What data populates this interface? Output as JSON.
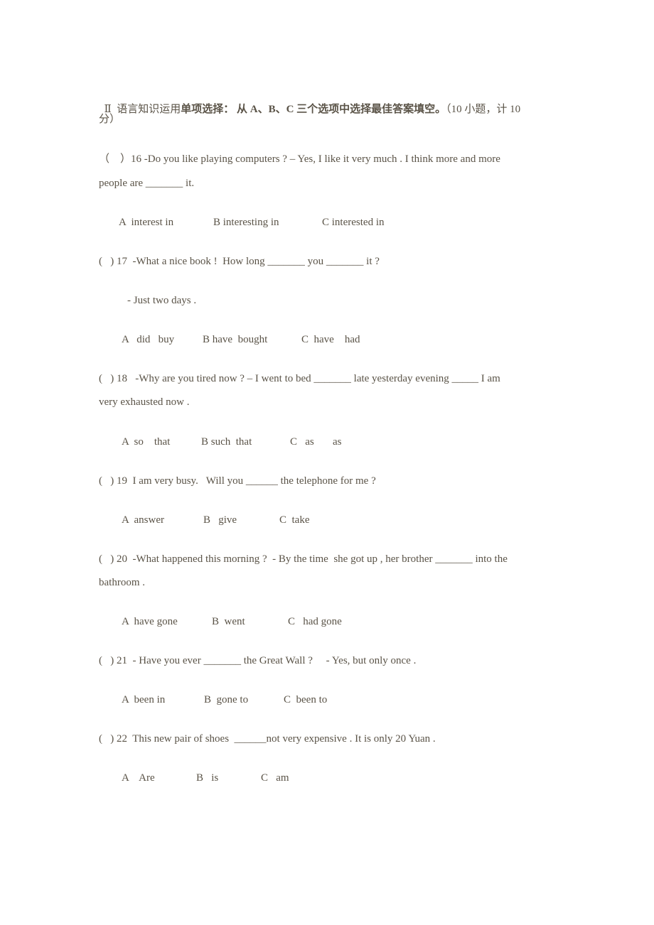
{
  "header": {
    "section_number": "Ⅱ",
    "section_title": "语言知识运用",
    "task_bold": "单项选择：",
    "instruction_bold": "从 A、B、C 三个选项中选择最佳答案填空。",
    "score_note_line1": "（10 小题，计 10",
    "score_note_line2": "分）"
  },
  "questions": [
    {
      "number": "16",
      "lines": [
        "（    ）16 -Do you like playing computers ? – Yes, I like it very much . I think more and more",
        "people are _______ it."
      ],
      "options": [
        "A  interest in",
        "B interesting in",
        "C interested in"
      ]
    },
    {
      "number": "17",
      "lines": [
        "(   ) 17  -What a nice book !  How long _______ you _______ it ?",
        "- Just two days ."
      ],
      "options": [
        "A   did   buy",
        "B have  bought",
        "C  have    had"
      ]
    },
    {
      "number": "18",
      "lines": [
        "(   ) 18   -Why are you tired now ? – I went to bed _______ late yesterday evening _____ I am",
        "very exhausted now ."
      ],
      "options": [
        "A  so    that",
        "B such  that",
        "C   as       as"
      ]
    },
    {
      "number": "19",
      "lines": [
        "(   ) 19  I am very busy.   Will you ______ the telephone for me ?"
      ],
      "options": [
        "A  answer",
        "B   give",
        "C  take"
      ]
    },
    {
      "number": "20",
      "lines": [
        "(   ) 20  -What happened this morning ?  - By the time  she got up , her brother _______ into the",
        "bathroom ."
      ],
      "options": [
        "A  have gone",
        "B  went",
        "C   had gone"
      ]
    },
    {
      "number": "21",
      "lines": [
        "(   ) 21  - Have you ever _______ the Great Wall ?     - Yes, but only once ."
      ],
      "options": [
        "A  been in",
        "B  gone to",
        "C  been to"
      ]
    },
    {
      "number": "22",
      "lines": [
        "(   ) 22  This new pair of shoes  ______not very expensive . It is only 20 Yuan ."
      ],
      "options": [
        "A    Are",
        "B   is",
        "C   am"
      ]
    }
  ]
}
